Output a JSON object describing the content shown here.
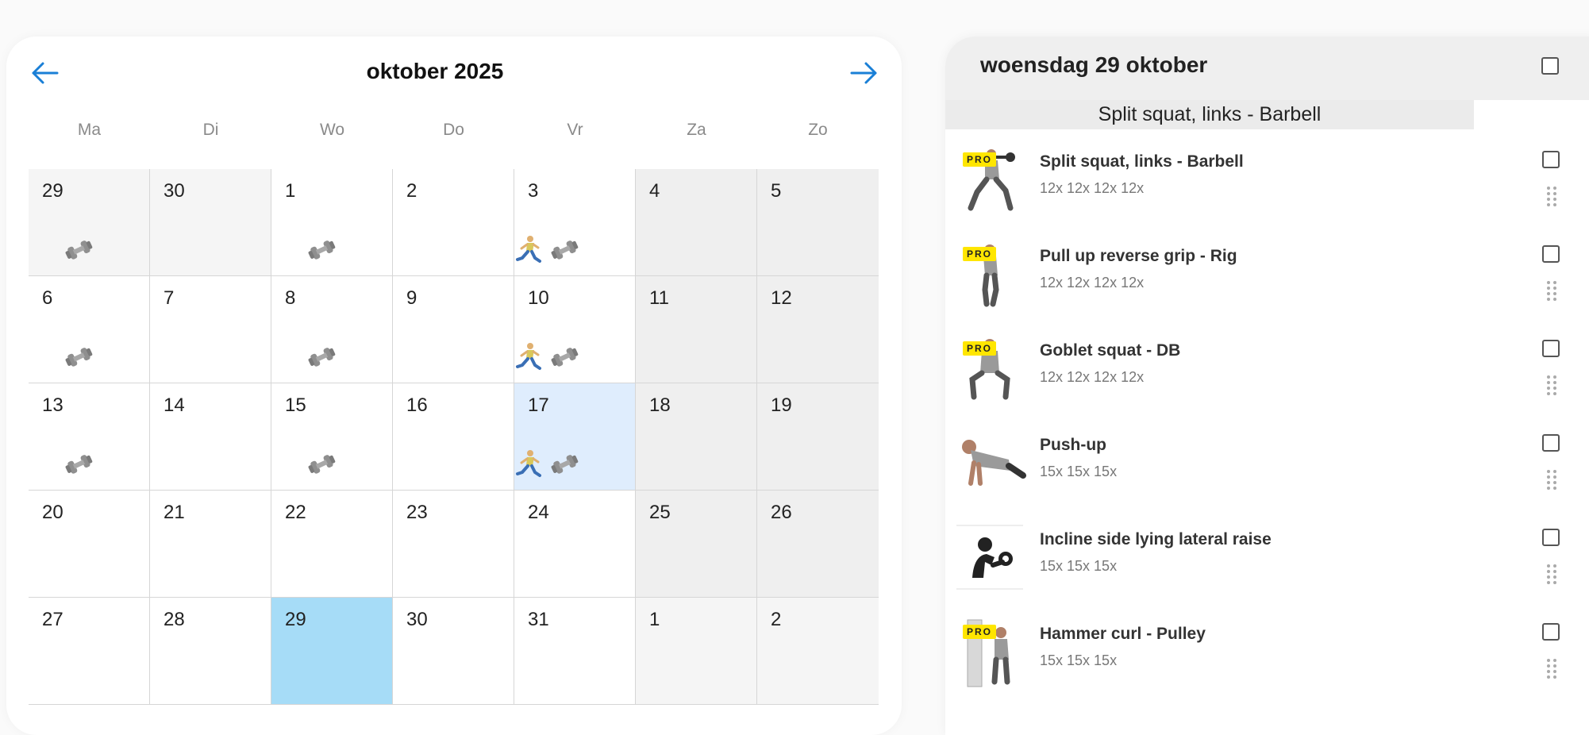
{
  "calendar": {
    "month_title": "oktober 2025",
    "weekdays": [
      "Ma",
      "Di",
      "Wo",
      "Do",
      "Vr",
      "Za",
      "Zo"
    ],
    "days": [
      "29",
      "30",
      "1",
      "2",
      "3",
      "4",
      "5",
      "6",
      "7",
      "8",
      "9",
      "10",
      "11",
      "12",
      "13",
      "14",
      "15",
      "16",
      "17",
      "18",
      "19",
      "20",
      "21",
      "22",
      "23",
      "24",
      "25",
      "26",
      "27",
      "28",
      "29",
      "30",
      "31",
      "1",
      "2"
    ],
    "icons": {
      "weights": "dumbbell-icon",
      "runner": "runner-icon",
      "prev": "arrow-left-icon",
      "next": "arrow-right-icon"
    },
    "colors": {
      "accent": "#1a7fd6",
      "selected": "#dfedfd",
      "today": "#a6dcf7",
      "weekend": "#efefef",
      "other_month": "#f5f5f5"
    }
  },
  "panel": {
    "title": "woensdag 29 oktober",
    "tooltip": "Split squat, links - Barbell",
    "pro_label": "PRO",
    "exercises": [
      {
        "name": "Split squat, links - Barbell",
        "sets": "12x 12x 12x 12x"
      },
      {
        "name": "Pull up reverse grip - Rig",
        "sets": "12x 12x 12x 12x"
      },
      {
        "name": "Goblet squat - DB",
        "sets": "12x 12x 12x 12x"
      },
      {
        "name": "Push-up",
        "sets": "15x 15x 15x"
      },
      {
        "name": "Incline side lying lateral raise",
        "sets": "15x 15x 15x"
      },
      {
        "name": "Hammer curl - Pulley",
        "sets": "15x 15x 15x"
      }
    ]
  }
}
